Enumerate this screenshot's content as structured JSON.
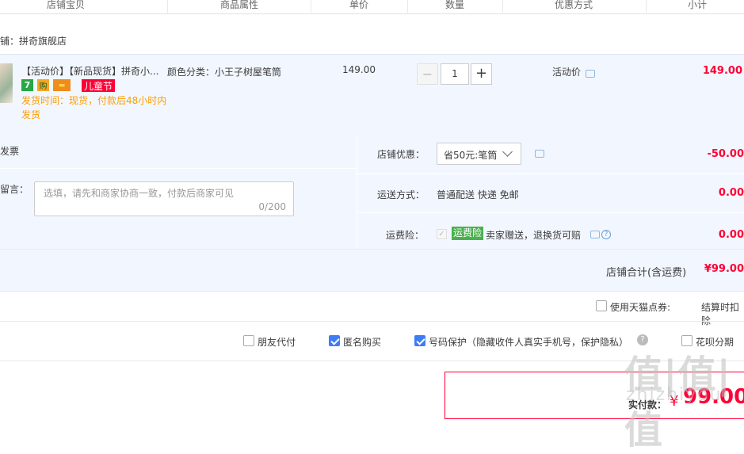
{
  "header": {
    "columns": [
      "店铺宝贝",
      "商品属性",
      "单价",
      "数量",
      "优惠方式",
      "小计"
    ]
  },
  "shop": {
    "name_label": "店铺：拼奇旗舰店"
  },
  "item": {
    "title": "【活动价】【新品现货】拼奇小...",
    "tags": [
      "7",
      "购",
      "▬",
      "儿童节"
    ],
    "ship_time": "发货时间：现货，付款后48小时内发货",
    "attribute": "颜色分类：小王子树屋笔筒",
    "price": "149.00",
    "quantity": "1",
    "minus": "−",
    "plus": "+",
    "promo": "活动价",
    "subtotal": "149.00"
  },
  "order": {
    "invoice_label": "开具发票",
    "memo_label": "给卖家留言：",
    "memo_placeholder": "选填，请先和商家协商一致，付款后商家可见",
    "memo_count": "0/200",
    "shop_discount_label": "店铺优惠：",
    "shop_discount_value": "省50元:笔筒",
    "shop_discount_amount": "-50.00",
    "delivery_label": "运送方式：",
    "delivery_value": "普通配送 快递 免邮",
    "delivery_amount": "0.00",
    "insurance_label": "运费险：",
    "insurance_badge": "运费险",
    "insurance_text": "卖家赠送，退换货可赔",
    "insurance_amount": "0.00",
    "total_label": "店铺合计(含运费)",
    "total_value": "¥99.00"
  },
  "points": {
    "use_label": "使用天猫点券:",
    "note": "结算时扣除"
  },
  "options": {
    "friend_pay": "朋友代付",
    "anonymous": "匿名购买",
    "number_protect": "号码保护（隐藏收件人真实手机号，保护隐私）",
    "huabei": "花呗分期"
  },
  "payment": {
    "label": "实付款：",
    "currency": "¥",
    "amount": "99.00"
  },
  "watermark": {
    "main": "值|值|值",
    "sub": "zhizhiyou"
  },
  "colors": {
    "accent_red": "#ff0036",
    "checkbox_blue": "#3d7df5",
    "ship_orange": "#ff9d00"
  }
}
